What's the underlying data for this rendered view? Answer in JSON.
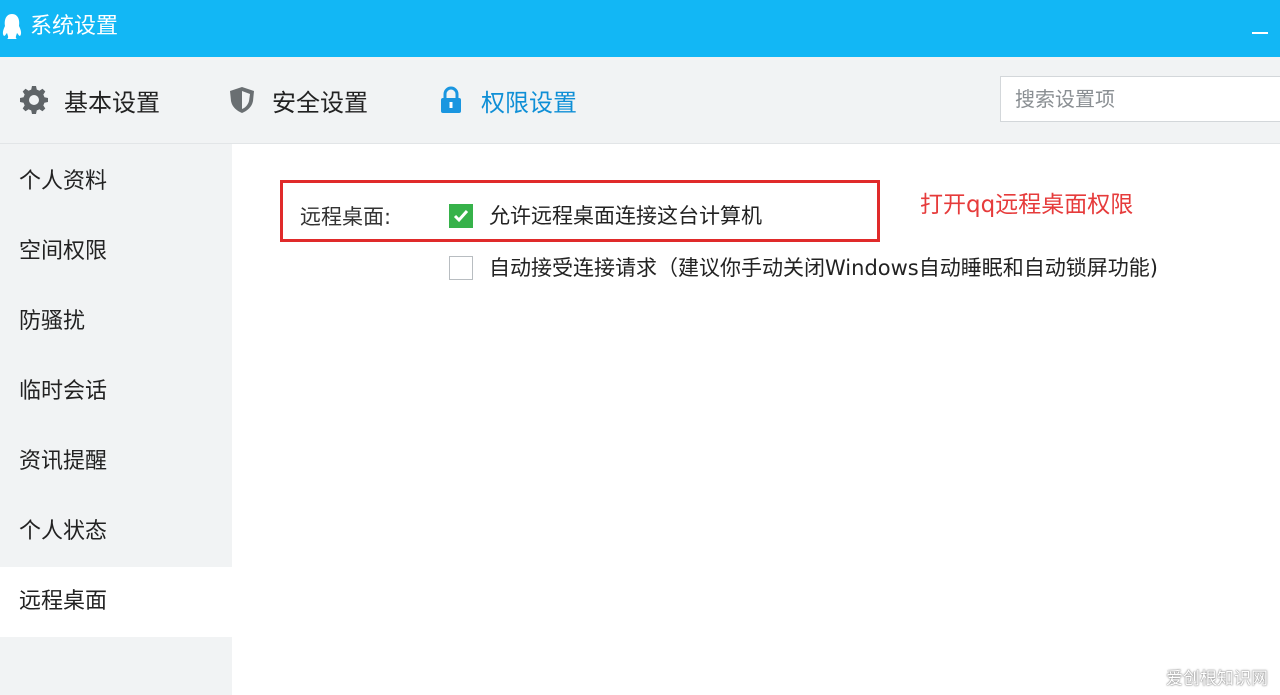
{
  "window": {
    "title": "系统设置",
    "brand_color": "#12b7f5",
    "minimize_icon": "minimize-icon"
  },
  "topnav": {
    "tabs": [
      {
        "label": "基本设置",
        "icon": "gear-icon"
      },
      {
        "label": "安全设置",
        "icon": "shield-icon"
      },
      {
        "label": "权限设置",
        "icon": "lock-icon",
        "active": true
      }
    ],
    "search_placeholder": "搜索设置项",
    "active_color": "#0f8fd6"
  },
  "sidebar": {
    "items": [
      {
        "label": "个人资料"
      },
      {
        "label": "空间权限"
      },
      {
        "label": "防骚扰"
      },
      {
        "label": "临时会话"
      },
      {
        "label": "资讯提醒"
      },
      {
        "label": "个人状态"
      },
      {
        "label": "远程桌面",
        "active": true
      }
    ]
  },
  "content": {
    "section_label": "远程桌面:",
    "options": [
      {
        "label": "允许远程桌面连接这台计算机",
        "checked": true
      },
      {
        "label": "自动接受连接请求（建议你手动关闭Windows自动睡眠和自动锁屏功能)",
        "checked": false
      }
    ],
    "annotation": "打开qq远程桌面权限",
    "annotation_color": "#e63b3b",
    "checkbox_checked_color": "#36b24a"
  },
  "watermark": "爱创根知识网"
}
